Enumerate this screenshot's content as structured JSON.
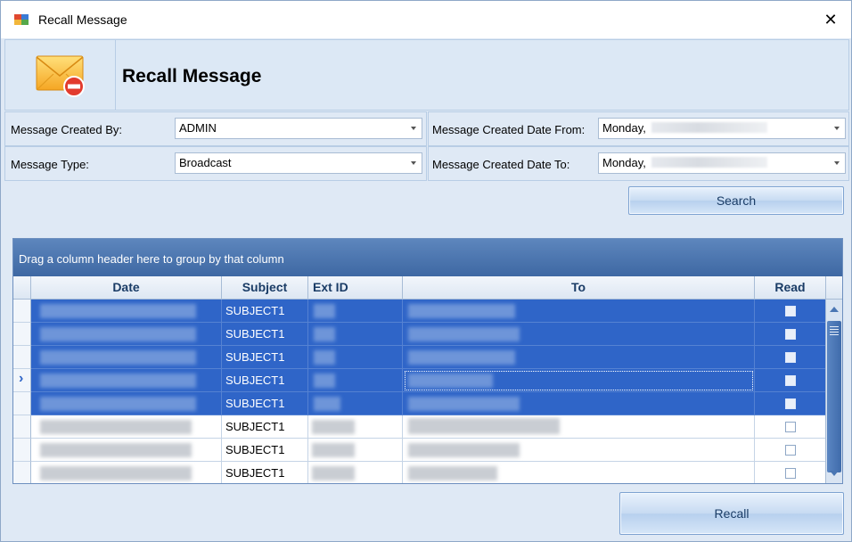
{
  "window": {
    "title": "Recall Message",
    "close_glyph": "✕"
  },
  "header": {
    "title": "Recall Message",
    "icon": "envelope-recall-icon"
  },
  "filters": {
    "created_by_label": "Message Created By:",
    "created_by_value": "ADMIN",
    "type_label": "Message Type:",
    "type_value": "Broadcast",
    "date_from_label": "Message Created Date From:",
    "date_from_value": "Monday,",
    "date_to_label": "Message Created Date To:",
    "date_to_value": "Monday,"
  },
  "search_button": "Search",
  "grid": {
    "group_hint": "Drag a column header here to group by that column",
    "columns": [
      "Date",
      "Subject",
      "Ext ID",
      "To",
      "Read"
    ],
    "current_row_glyph": "›",
    "rows": [
      {
        "subject": "SUBJECT1",
        "selected": true
      },
      {
        "subject": "SUBJECT1",
        "selected": true
      },
      {
        "subject": "SUBJECT1",
        "selected": true
      },
      {
        "subject": "SUBJECT1",
        "selected": true,
        "current": true
      },
      {
        "subject": "SUBJECT1",
        "selected": true
      },
      {
        "subject": "SUBJECT1",
        "selected": false
      },
      {
        "subject": "SUBJECT1",
        "selected": false
      },
      {
        "subject": "SUBJECT1",
        "selected": false
      }
    ]
  },
  "recall_button": "Recall",
  "colors": {
    "selection": "#2f65c8",
    "group_panel": "#4a74ad",
    "window_bg": "#dfe9f5"
  }
}
